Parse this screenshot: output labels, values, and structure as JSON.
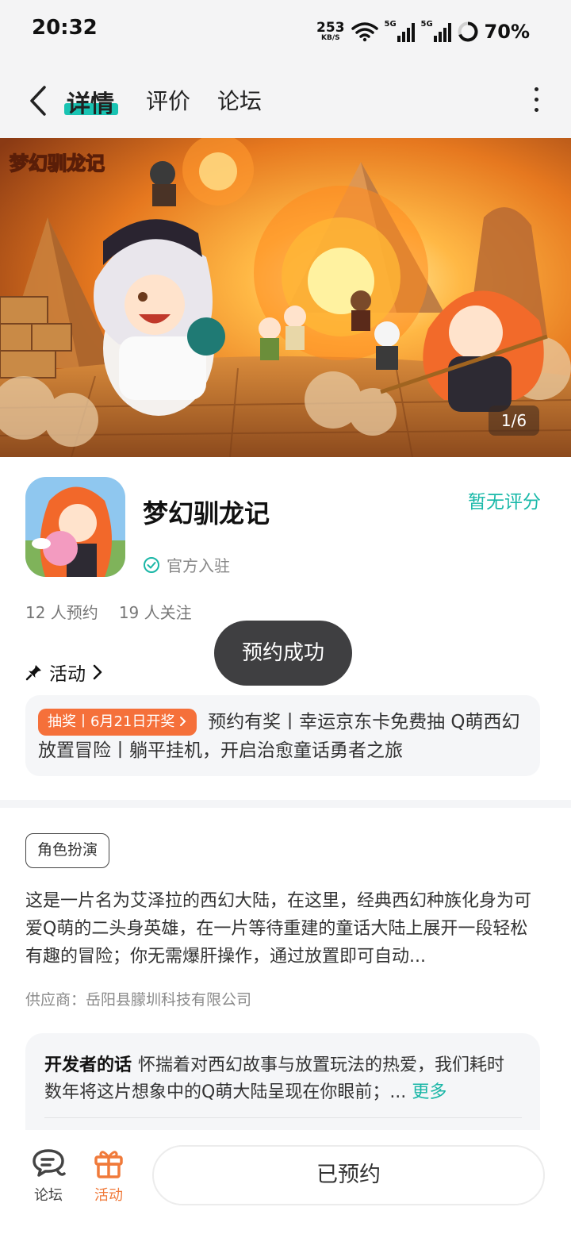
{
  "status_bar": {
    "time": "20:32",
    "net_speed": "253",
    "net_unit": "KB/S",
    "sim1": "5G",
    "sim2": "5G",
    "battery": "70%"
  },
  "nav": {
    "tabs": [
      {
        "label": "详情",
        "active": true
      },
      {
        "label": "评价",
        "active": false
      },
      {
        "label": "论坛",
        "active": false
      }
    ]
  },
  "banner": {
    "logo_text": "梦幻驯龙记",
    "counter": "1/6"
  },
  "app": {
    "name": "梦幻驯龙记",
    "official_label": "官方入驻",
    "rating": "暂无评分",
    "reservations": "12 人预约",
    "followers": "19 人关注"
  },
  "activity": {
    "title": "活动",
    "badge": "抽奖丨6月21日开奖",
    "text": "预约有奖丨幸运京东卡免费抽 Q萌西幻放置冒险丨躺平挂机，开启治愈童话勇者之旅"
  },
  "toast": "预约成功",
  "details": {
    "genre_tag": "角色扮演",
    "description": "这是一片名为艾泽拉的西幻大陆，在这里，经典西幻种族化身为可爱Q萌的二头身英雄，在一片等待重建的童话大陆上展开一段轻松有趣的冒险；你无需爆肝操作，通过放置即可自动...",
    "supplier": "供应商：岳阳县朦圳科技有限公司"
  },
  "developer_note": {
    "label": "开发者的话",
    "text": "怀揣着对西幻故事与放置玩法的热爱，我们耗时数年将这片想象中的Q萌大陆呈现在你眼前；...",
    "more": "更多"
  },
  "bottom_bar": {
    "forum_label": "论坛",
    "activity_label": "活动",
    "reserve_button": "已预约"
  },
  "colors": {
    "accent": "#19c3b2",
    "promo": "#f5703a",
    "activity_tab": "#f07a3a"
  }
}
